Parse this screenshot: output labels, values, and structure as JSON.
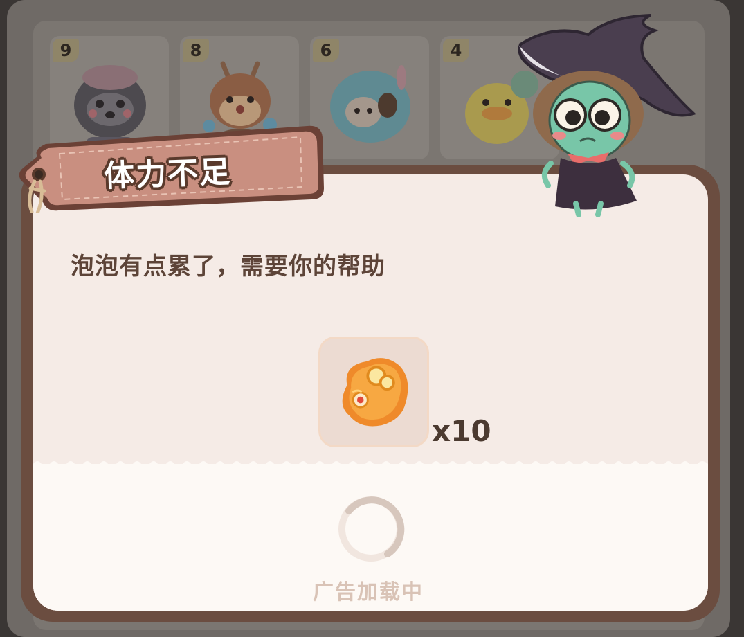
{
  "background": {
    "cards": [
      {
        "level": "9",
        "character": "raccoon"
      },
      {
        "level": "8",
        "character": "deer"
      },
      {
        "level": "6",
        "character": "sheep"
      },
      {
        "level": "4",
        "character": "duck"
      }
    ]
  },
  "dialog": {
    "title": "体力不足",
    "message": "泡泡有点累了，需要你的帮助",
    "reward": {
      "icon": "energy-bread-icon",
      "quantity": "x10"
    },
    "loading_text": "广告加载中"
  },
  "colors": {
    "frame": "#6b4d40",
    "paper": "#f5ebe6",
    "tag": "#c98f80",
    "text_dark": "#5d4438",
    "loading_text": "#d9c3b6"
  }
}
